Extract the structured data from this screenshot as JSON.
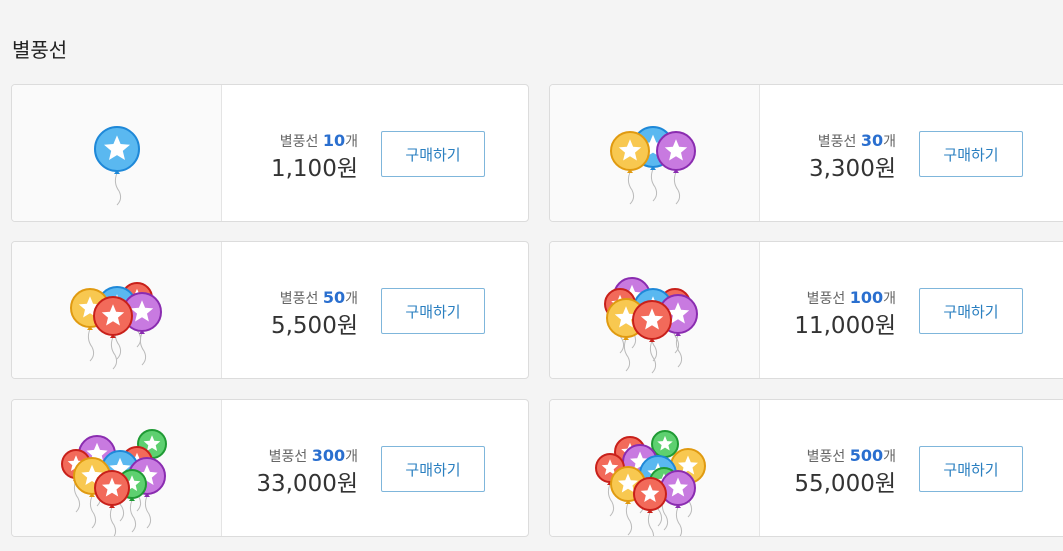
{
  "page_title": "별풍선",
  "products": [
    {
      "name": "별풍선",
      "count": "10",
      "unit": "개",
      "price": "1,100원",
      "button": "구매하기",
      "icon": "balloon-icon-10"
    },
    {
      "name": "별풍선",
      "count": "30",
      "unit": "개",
      "price": "3,300원",
      "button": "구매하기",
      "icon": "balloon-icon-30"
    },
    {
      "name": "별풍선",
      "count": "50",
      "unit": "개",
      "price": "5,500원",
      "button": "구매하기",
      "icon": "balloon-icon-50"
    },
    {
      "name": "별풍선",
      "count": "100",
      "unit": "개",
      "price": "11,000원",
      "button": "구매하기",
      "icon": "balloon-icon-100"
    },
    {
      "name": "별풍선",
      "count": "300",
      "unit": "개",
      "price": "33,000원",
      "button": "구매하기",
      "icon": "balloon-icon-300"
    },
    {
      "name": "별풍선",
      "count": "500",
      "unit": "개",
      "price": "55,000원",
      "button": "구매하기",
      "icon": "balloon-icon-500"
    }
  ],
  "colors": {
    "accent": "#2a6fcf",
    "button_border": "#7fb6db",
    "button_text": "#2a7fc0",
    "background": "#f4f4f4"
  }
}
